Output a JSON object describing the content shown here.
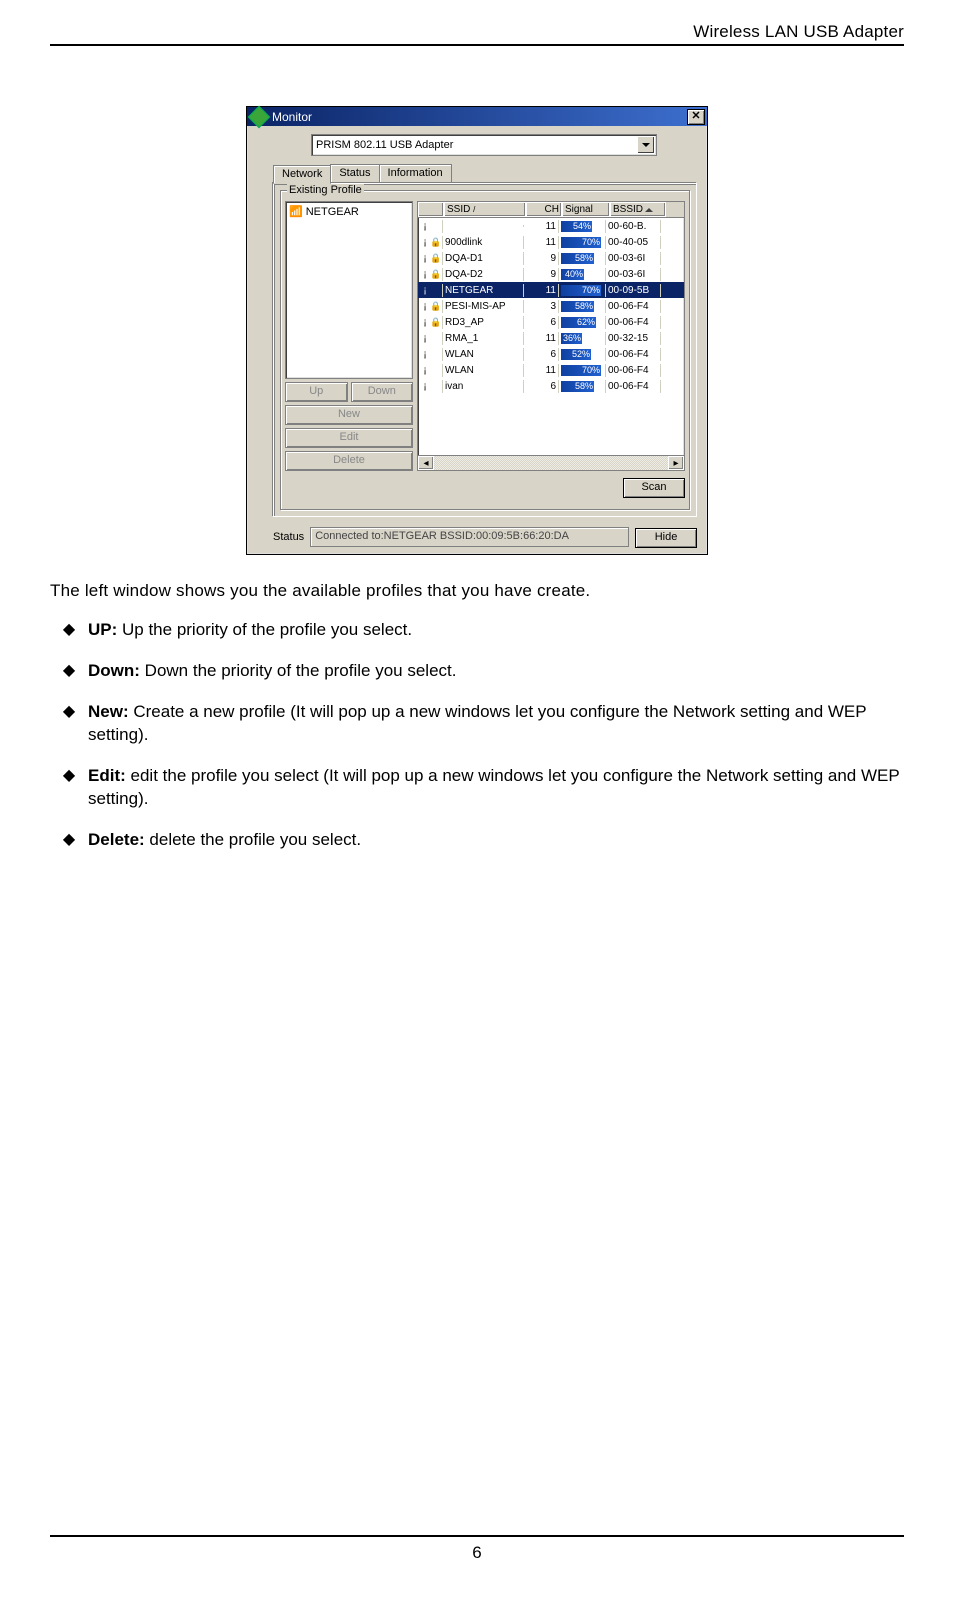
{
  "header": {
    "title": "Wireless LAN USB Adapter"
  },
  "window": {
    "title": "Monitor",
    "adapter": "PRISM 802.11 USB Adapter",
    "tabs": [
      "Network",
      "Status",
      "Information"
    ],
    "group_label": "Existing Profile",
    "profiles": [
      {
        "name": "NETGEAR"
      }
    ],
    "buttons": {
      "up": "Up",
      "down": "Down",
      "new": "New",
      "edit": "Edit",
      "delete": "Delete",
      "scan": "Scan",
      "hide": "Hide"
    },
    "columns": {
      "ssid": "SSID",
      "ch": "CH",
      "signal": "Signal",
      "bssid": "BSSID"
    },
    "networks": [
      {
        "ssid": "",
        "ch": "11",
        "signal": "54%",
        "bssid": "00-60-B.",
        "lock": false,
        "selected": false
      },
      {
        "ssid": "900dlink",
        "ch": "11",
        "signal": "70%",
        "bssid": "00-40-05",
        "lock": true,
        "selected": false
      },
      {
        "ssid": "DQA-D1",
        "ch": "9",
        "signal": "58%",
        "bssid": "00-03-6I",
        "lock": true,
        "selected": false
      },
      {
        "ssid": "DQA-D2",
        "ch": "9",
        "signal": "40%",
        "bssid": "00-03-6I",
        "lock": true,
        "selected": false
      },
      {
        "ssid": "NETGEAR",
        "ch": "11",
        "signal": "70%",
        "bssid": "00-09-5B",
        "lock": false,
        "selected": true
      },
      {
        "ssid": "PESI-MIS-AP",
        "ch": "3",
        "signal": "58%",
        "bssid": "00-06-F4",
        "lock": true,
        "selected": false
      },
      {
        "ssid": "RD3_AP",
        "ch": "6",
        "signal": "62%",
        "bssid": "00-06-F4",
        "lock": true,
        "selected": false
      },
      {
        "ssid": "RMA_1",
        "ch": "11",
        "signal": "36%",
        "bssid": "00-32-15",
        "lock": false,
        "selected": false
      },
      {
        "ssid": "WLAN",
        "ch": "6",
        "signal": "52%",
        "bssid": "00-06-F4",
        "lock": false,
        "selected": false
      },
      {
        "ssid": "WLAN",
        "ch": "11",
        "signal": "70%",
        "bssid": "00-06-F4",
        "lock": false,
        "selected": false
      },
      {
        "ssid": "ivan",
        "ch": "6",
        "signal": "58%",
        "bssid": "00-06-F4",
        "lock": false,
        "selected": false
      }
    ],
    "status_label": "Status",
    "status_text": "Connected to:NETGEAR    BSSID:00:09:5B:66:20:DA"
  },
  "intro": "The left window shows you the available profiles that you have create.",
  "bullets": [
    {
      "term": "UP:",
      "text": " Up the priority of the profile you select."
    },
    {
      "term": "Down:",
      "text": " Down the priority of the profile you select."
    },
    {
      "term": "New:",
      "text": " Create a new profile (It will pop up a new windows let you configure the Network setting and WEP setting)."
    },
    {
      "term": "Edit:",
      "text": " edit the profile you select (It will pop up a new windows let you configure the Network setting and WEP setting)."
    },
    {
      "term": "Delete:",
      "text": " delete the profile you select."
    }
  ],
  "page_number": "6"
}
